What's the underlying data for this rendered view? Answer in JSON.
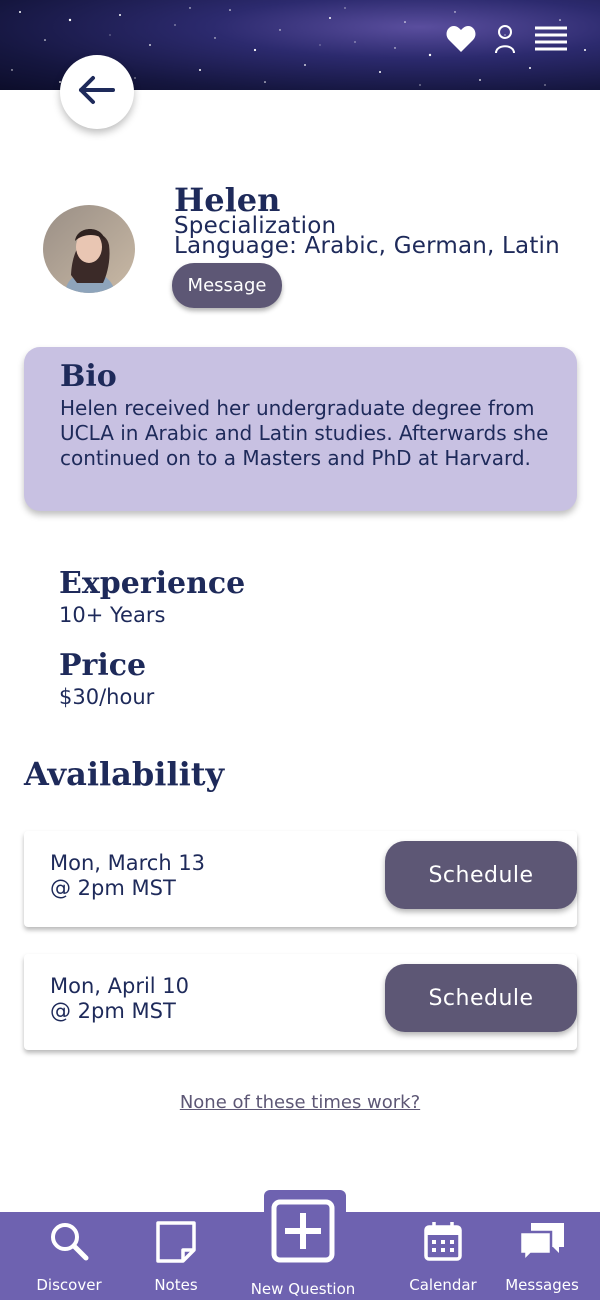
{
  "profile": {
    "name": "Helen",
    "specialization": "Specialization",
    "language": "Language: Arabic, German, Latin",
    "message_label": "Message"
  },
  "bio": {
    "title": "Bio",
    "text": "Helen received her undergraduate degree from UCLA in Arabic and Latin studies. Afterwards she continued on to a Masters and PhD at Harvard."
  },
  "experience": {
    "title": "Experience",
    "value": "10+ Years"
  },
  "price": {
    "title": "Price",
    "value": "$30/hour"
  },
  "availability": {
    "title": "Availability",
    "slots": [
      {
        "date": "Mon, March 13",
        "time": "@ 2pm MST",
        "button": "Schedule"
      },
      {
        "date": "Mon, April 10",
        "time": "@ 2pm MST",
        "button": "Schedule"
      }
    ],
    "none_link": "None of these times work?"
  },
  "nav": {
    "items": [
      {
        "label": "Discover",
        "icon": "search-icon"
      },
      {
        "label": "Notes",
        "icon": "note-icon"
      },
      {
        "label": "New Question",
        "icon": "plus-box-icon"
      },
      {
        "label": "Calendar",
        "icon": "calendar-icon"
      },
      {
        "label": "Messages",
        "icon": "chat-bubbles-icon"
      }
    ]
  },
  "header": {
    "icons": [
      "heart-icon",
      "user-icon",
      "menu-icon"
    ]
  },
  "colors": {
    "navy": "#1e2a5a",
    "bio_bg": "#c8c1e2",
    "button": "#5d5775",
    "nav_bg": "#6e62b0"
  }
}
